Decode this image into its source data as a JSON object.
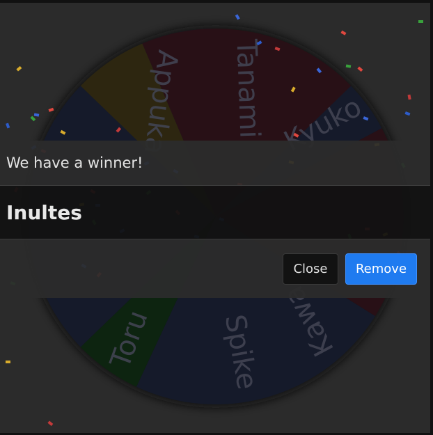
{
  "wheel": {
    "labels": {
      "top_left": "Appuka",
      "top_center": "Tanami",
      "top_right": "Kyuko",
      "bottom_center": "Spike",
      "bottom_left": "Toru",
      "bottom_right": "Kawa"
    },
    "slice_colors": {
      "red": "#281016",
      "navy": "#151a2a",
      "green": "#0d2410",
      "olive": "#2d2610"
    }
  },
  "dialog": {
    "title": "We have a winner!",
    "winner_name": "Inultes",
    "close_label": "Close",
    "remove_label": "Remove"
  },
  "colors": {
    "backdrop": "#2b2b2b",
    "primary_button": "#1f7bf0"
  }
}
